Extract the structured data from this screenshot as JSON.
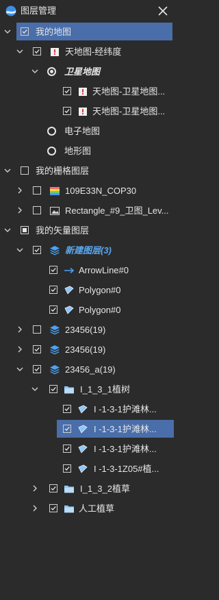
{
  "titlebar": {
    "title": "图层管理"
  },
  "tree": {
    "my_map": {
      "label": "我的地图",
      "tianditu_latlon": {
        "label": "天地图-经纬度",
        "satellite": {
          "label": "卫星地图",
          "layer1": "天地图-卫星地图...",
          "layer2": "天地图-卫星地图..."
        },
        "electronic": "电子地图",
        "terrain": "地形图"
      }
    },
    "my_raster": {
      "label": "我的栅格图层",
      "item1": "109E33N_COP30",
      "item2": "Rectangle_#9_卫图_Lev..."
    },
    "my_vector": {
      "label": "我的矢量图层",
      "new_layer": {
        "label": "新建图层(3)",
        "arrowline": "ArrowLine#0",
        "polygon1": "Polygon#0",
        "polygon2": "Polygon#0"
      },
      "group_23456_a": "23456(19)",
      "group_23456_b": "23456(19)",
      "group_23456_c": {
        "label": "23456_a(19)",
        "folder1": {
          "label": "I_1_3_1植树",
          "item1": "I -1-3-1护滩林...",
          "item2": "I -1-3-1护滩林...",
          "item3": "I -1-3-1护滩林...",
          "item4": "I -1-3-1Z05#植..."
        },
        "folder2": "I_1_3_2植草",
        "folder3": "人工植草"
      }
    }
  },
  "colors": {
    "background": "#2b2b2b",
    "selection": "#4a6ea9",
    "new_layer_text": "#5aa8f0",
    "layers_icon": "#4aa3f5"
  }
}
